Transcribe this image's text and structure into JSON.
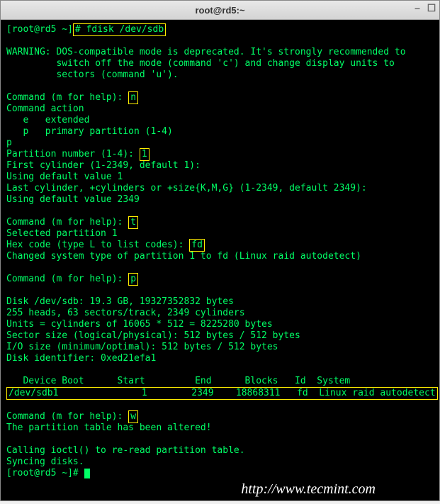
{
  "window": {
    "title": "root@rd5:~"
  },
  "prompt1": {
    "pre": "[root@rd5 ~]",
    "cmd": "# fdisk /dev/sdb"
  },
  "warn": {
    "l1": "WARNING: DOS-compatible mode is deprecated. It's strongly recommended to",
    "l2": "         switch off the mode (command 'c') and change display units to",
    "l3": "         sectors (command 'u')."
  },
  "cmd_n": {
    "label": "Command (m for help): ",
    "input": "n"
  },
  "action": {
    "hdr": "Command action",
    "e": "   e   extended",
    "p": "   p   primary partition (1-4)",
    "choice": "p"
  },
  "partnum": {
    "label": "Partition number (1-4): ",
    "input": "1"
  },
  "firstcyl": "First cylinder (1-2349, default 1): ",
  "def1": "Using default value 1",
  "lastcyl": "Last cylinder, +cylinders or +size{K,M,G} (1-2349, default 2349): ",
  "def2349": "Using default value 2349",
  "cmd_t": {
    "label": "Command (m for help): ",
    "input": "t"
  },
  "selpart": "Selected partition 1",
  "hex": {
    "label": "Hex code (type L to list codes): ",
    "input": "fd"
  },
  "changed": "Changed system type of partition 1 to fd (Linux raid autodetect)",
  "cmd_p": {
    "label": "Command (m for help): ",
    "input": "p"
  },
  "disk": {
    "l1": "Disk /dev/sdb: 19.3 GB, 19327352832 bytes",
    "l2": "255 heads, 63 sectors/track, 2349 cylinders",
    "l3": "Units = cylinders of 16065 * 512 = 8225280 bytes",
    "l4": "Sector size (logical/physical): 512 bytes / 512 bytes",
    "l5": "I/O size (minimum/optimal): 512 bytes / 512 bytes",
    "l6": "Disk identifier: 0xed21efa1"
  },
  "table": {
    "hdr": "   Device Boot      Start         End      Blocks   Id  System",
    "row": "/dev/sdb1               1        2349    18868311   fd  Linux raid autodetect"
  },
  "cmd_w": {
    "label": "Command (m for help): ",
    "input": "w"
  },
  "altered": "The partition table has been altered!",
  "ioctl": "Calling ioctl() to re-read partition table.",
  "sync": "Syncing disks.",
  "prompt2": "[root@rd5 ~]# ",
  "watermark": "http://www.tecmint.com"
}
